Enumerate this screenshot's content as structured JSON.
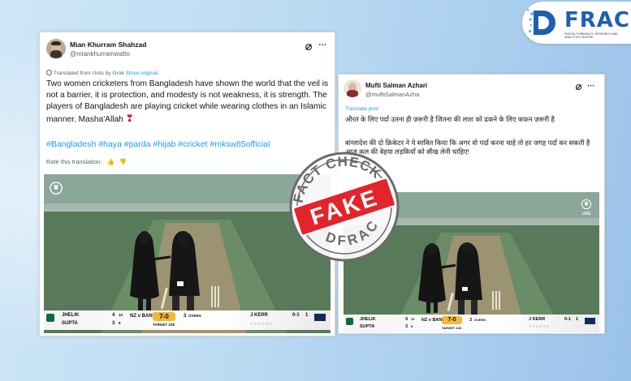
{
  "logo": {
    "text": "FRAC",
    "tagline": "DIGITAL FORENSICS, RESEARCH AND ANALYTICS CENTRE",
    "brand_color": "#1f5fb0"
  },
  "tweet_left": {
    "author_name": "Mian Khurram Shahzad",
    "author_handle": "@miankhurramwatto",
    "translation_label": "Translated from Urdu by Grok",
    "show_original_label": "Show original",
    "text": "Two women cricketers from Bangladesh have shown the world that the veil is not a barrier, it is protection, and modesty is not weakness, it is strength. The players of Bangladesh are playing cricket while wearing clothes in an Islamic manner. Masha'Allah",
    "hashtags": "#Bangladesh #haya #parda #hijab #cricket #mksw85official",
    "rate_label": "Rate this translation:",
    "icons": [
      "grok-icon",
      "more-dots-icon",
      "heart-icon",
      "thumbs-up-icon",
      "thumbs-down-icon"
    ]
  },
  "tweet_right": {
    "author_name": "Mufti Salman Azhari",
    "author_handle": "@muftiSalmanAzha",
    "translate_label": "Translate post",
    "text_line1": "औरत के लिए पर्दा उतना ही ज़रूरी है जितना की लाश को ढकने के लिए कफ़न ज़रूरी है",
    "text_line2": "बांग्लादेश की दो क्रिकेटर ने ये साबित किया कि अगर वो पर्दा करना चाहे तो हर जगह पर्दा कर सकती है आज कल की बेहया लड़कियों को सीख लेनी चाहिए!",
    "icons": [
      "grok-icon",
      "more-dots-icon"
    ]
  },
  "scoreboard": {
    "batter1": "JHELIK",
    "batter1_runs": "4",
    "batter1_balls": "10",
    "batter2": "SUPTA",
    "batter2_runs": "3",
    "batter2_balls": "8",
    "teams": "NZ v BAN",
    "score": "7-0",
    "overs": "3",
    "overs_label": "OVERS",
    "target": "TARGET 228",
    "bowler": "J KERR",
    "bowler_figures": "0-1",
    "bowler_overs": "1",
    "live_label": "LIVE"
  },
  "stamp": {
    "top_text": "FACT CHECK",
    "center_text": "FAKE",
    "bottom_text": "DFRAC",
    "red": "#e3252b",
    "grey": "#6b6b6b"
  }
}
